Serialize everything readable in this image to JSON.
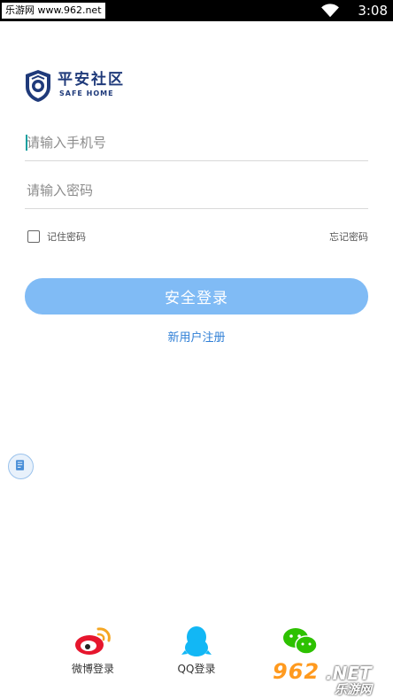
{
  "status_bar": {
    "watermark": "乐游网 www.962.net",
    "time": "3:08",
    "wifi_icon": "wifi-icon"
  },
  "logo": {
    "title": "平安社区",
    "subtitle": "SAFE HOME",
    "badge_icon": "police-badge-icon",
    "brand_color": "#1f3a7a"
  },
  "form": {
    "phone_placeholder": "请输入手机号",
    "phone_value": "",
    "password_placeholder": "请输入密码",
    "password_value": "",
    "remember_label": "记住密码",
    "remember_checked": false,
    "forgot_label": "忘记密码",
    "login_label": "安全登录",
    "register_label": "新用户注册"
  },
  "colors": {
    "login_button": "#80bbf5",
    "link": "#2f7fd6",
    "caret": "#16a0a0"
  },
  "social": [
    {
      "label": "微博登录",
      "icon": "weibo-icon"
    },
    {
      "label": "QQ登录",
      "icon": "qq-icon"
    },
    {
      "label": "",
      "icon": "wechat-icon"
    }
  ],
  "watermark": {
    "number": "962",
    "net": ".NET",
    "cn": "乐游网"
  }
}
